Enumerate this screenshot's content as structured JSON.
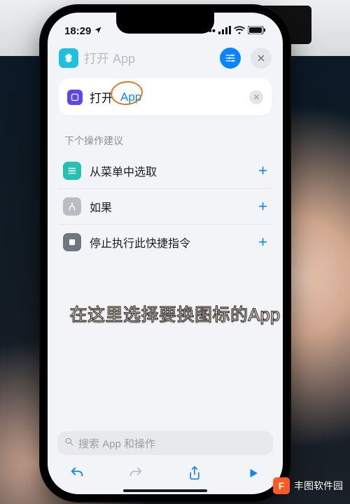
{
  "status": {
    "time": "18:29",
    "nav_icon": "location-arrow"
  },
  "header": {
    "title_placeholder": "打开 App"
  },
  "action": {
    "label": "打开",
    "app_placeholder": "App"
  },
  "suggestions": {
    "heading": "下个操作建议",
    "items": [
      {
        "icon": "menu-icon",
        "label": "从菜单中选取"
      },
      {
        "icon": "if-icon",
        "label": "如果"
      },
      {
        "icon": "stop-icon",
        "label": "停止执行此快捷指令"
      }
    ]
  },
  "search": {
    "placeholder": "搜索 App 和操作"
  },
  "caption": "在这里选择要换图标的App",
  "watermark": {
    "logo": "F",
    "text": "丰图软件园"
  },
  "colors": {
    "accent": "#0a84ff"
  }
}
